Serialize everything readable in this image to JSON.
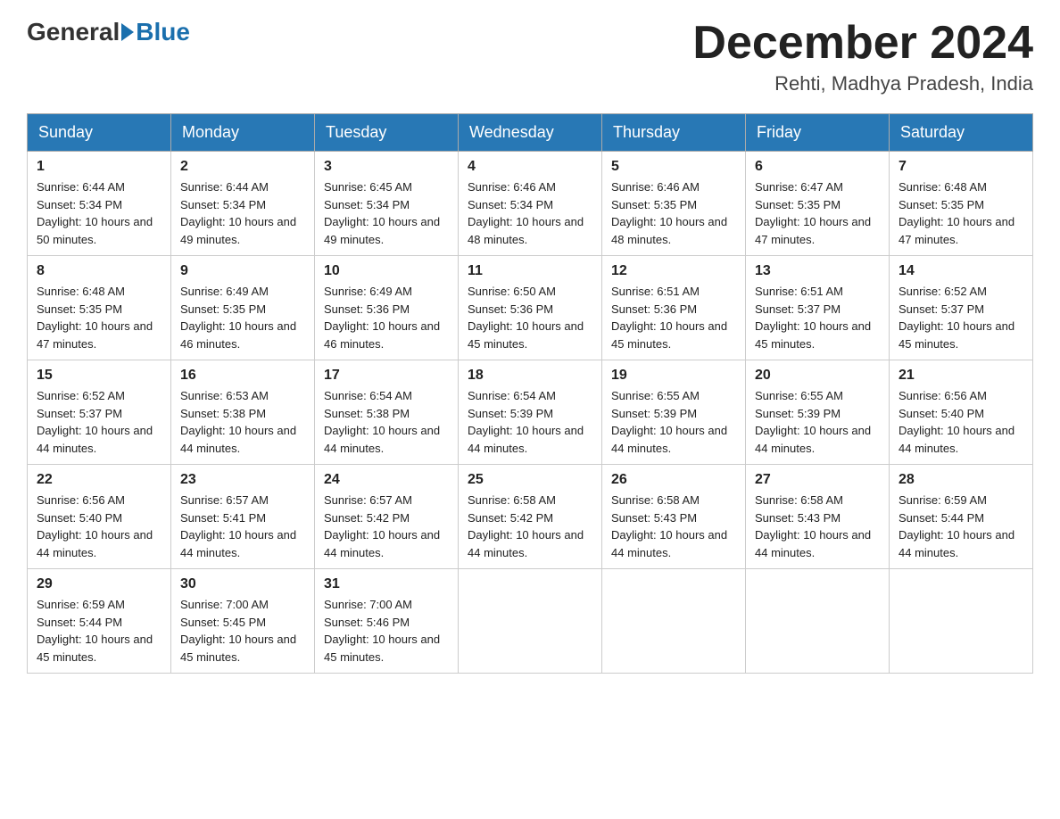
{
  "header": {
    "logo_general": "General",
    "logo_blue": "Blue",
    "month_title": "December 2024",
    "location": "Rehti, Madhya Pradesh, India"
  },
  "days_of_week": [
    "Sunday",
    "Monday",
    "Tuesday",
    "Wednesday",
    "Thursday",
    "Friday",
    "Saturday"
  ],
  "weeks": [
    [
      {
        "day": "1",
        "sunrise": "6:44 AM",
        "sunset": "5:34 PM",
        "daylight": "10 hours and 50 minutes."
      },
      {
        "day": "2",
        "sunrise": "6:44 AM",
        "sunset": "5:34 PM",
        "daylight": "10 hours and 49 minutes."
      },
      {
        "day": "3",
        "sunrise": "6:45 AM",
        "sunset": "5:34 PM",
        "daylight": "10 hours and 49 minutes."
      },
      {
        "day": "4",
        "sunrise": "6:46 AM",
        "sunset": "5:34 PM",
        "daylight": "10 hours and 48 minutes."
      },
      {
        "day": "5",
        "sunrise": "6:46 AM",
        "sunset": "5:35 PM",
        "daylight": "10 hours and 48 minutes."
      },
      {
        "day": "6",
        "sunrise": "6:47 AM",
        "sunset": "5:35 PM",
        "daylight": "10 hours and 47 minutes."
      },
      {
        "day": "7",
        "sunrise": "6:48 AM",
        "sunset": "5:35 PM",
        "daylight": "10 hours and 47 minutes."
      }
    ],
    [
      {
        "day": "8",
        "sunrise": "6:48 AM",
        "sunset": "5:35 PM",
        "daylight": "10 hours and 47 minutes."
      },
      {
        "day": "9",
        "sunrise": "6:49 AM",
        "sunset": "5:35 PM",
        "daylight": "10 hours and 46 minutes."
      },
      {
        "day": "10",
        "sunrise": "6:49 AM",
        "sunset": "5:36 PM",
        "daylight": "10 hours and 46 minutes."
      },
      {
        "day": "11",
        "sunrise": "6:50 AM",
        "sunset": "5:36 PM",
        "daylight": "10 hours and 45 minutes."
      },
      {
        "day": "12",
        "sunrise": "6:51 AM",
        "sunset": "5:36 PM",
        "daylight": "10 hours and 45 minutes."
      },
      {
        "day": "13",
        "sunrise": "6:51 AM",
        "sunset": "5:37 PM",
        "daylight": "10 hours and 45 minutes."
      },
      {
        "day": "14",
        "sunrise": "6:52 AM",
        "sunset": "5:37 PM",
        "daylight": "10 hours and 45 minutes."
      }
    ],
    [
      {
        "day": "15",
        "sunrise": "6:52 AM",
        "sunset": "5:37 PM",
        "daylight": "10 hours and 44 minutes."
      },
      {
        "day": "16",
        "sunrise": "6:53 AM",
        "sunset": "5:38 PM",
        "daylight": "10 hours and 44 minutes."
      },
      {
        "day": "17",
        "sunrise": "6:54 AM",
        "sunset": "5:38 PM",
        "daylight": "10 hours and 44 minutes."
      },
      {
        "day": "18",
        "sunrise": "6:54 AM",
        "sunset": "5:39 PM",
        "daylight": "10 hours and 44 minutes."
      },
      {
        "day": "19",
        "sunrise": "6:55 AM",
        "sunset": "5:39 PM",
        "daylight": "10 hours and 44 minutes."
      },
      {
        "day": "20",
        "sunrise": "6:55 AM",
        "sunset": "5:39 PM",
        "daylight": "10 hours and 44 minutes."
      },
      {
        "day": "21",
        "sunrise": "6:56 AM",
        "sunset": "5:40 PM",
        "daylight": "10 hours and 44 minutes."
      }
    ],
    [
      {
        "day": "22",
        "sunrise": "6:56 AM",
        "sunset": "5:40 PM",
        "daylight": "10 hours and 44 minutes."
      },
      {
        "day": "23",
        "sunrise": "6:57 AM",
        "sunset": "5:41 PM",
        "daylight": "10 hours and 44 minutes."
      },
      {
        "day": "24",
        "sunrise": "6:57 AM",
        "sunset": "5:42 PM",
        "daylight": "10 hours and 44 minutes."
      },
      {
        "day": "25",
        "sunrise": "6:58 AM",
        "sunset": "5:42 PM",
        "daylight": "10 hours and 44 minutes."
      },
      {
        "day": "26",
        "sunrise": "6:58 AM",
        "sunset": "5:43 PM",
        "daylight": "10 hours and 44 minutes."
      },
      {
        "day": "27",
        "sunrise": "6:58 AM",
        "sunset": "5:43 PM",
        "daylight": "10 hours and 44 minutes."
      },
      {
        "day": "28",
        "sunrise": "6:59 AM",
        "sunset": "5:44 PM",
        "daylight": "10 hours and 44 minutes."
      }
    ],
    [
      {
        "day": "29",
        "sunrise": "6:59 AM",
        "sunset": "5:44 PM",
        "daylight": "10 hours and 45 minutes."
      },
      {
        "day": "30",
        "sunrise": "7:00 AM",
        "sunset": "5:45 PM",
        "daylight": "10 hours and 45 minutes."
      },
      {
        "day": "31",
        "sunrise": "7:00 AM",
        "sunset": "5:46 PM",
        "daylight": "10 hours and 45 minutes."
      },
      null,
      null,
      null,
      null
    ]
  ]
}
